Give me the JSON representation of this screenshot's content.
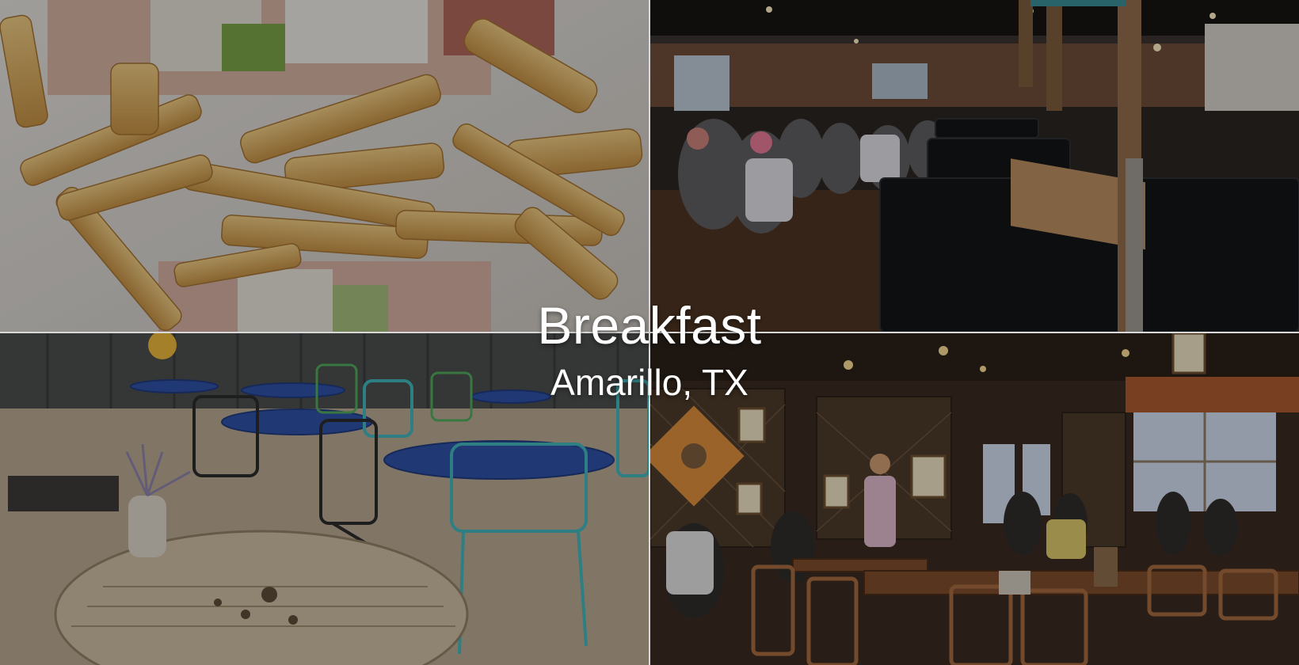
{
  "overlay": {
    "title": "Breakfast",
    "subtitle": "Amarillo, TX"
  },
  "photos": [
    {
      "subject": "sandwich-and-fries"
    },
    {
      "subject": "restaurant-dining-room-booths"
    },
    {
      "subject": "outdoor-patio-tables"
    },
    {
      "subject": "restaurant-interior-wood-tables"
    }
  ],
  "colors": {
    "divider": "#d8d8d8",
    "overlay_text": "#ffffff"
  }
}
